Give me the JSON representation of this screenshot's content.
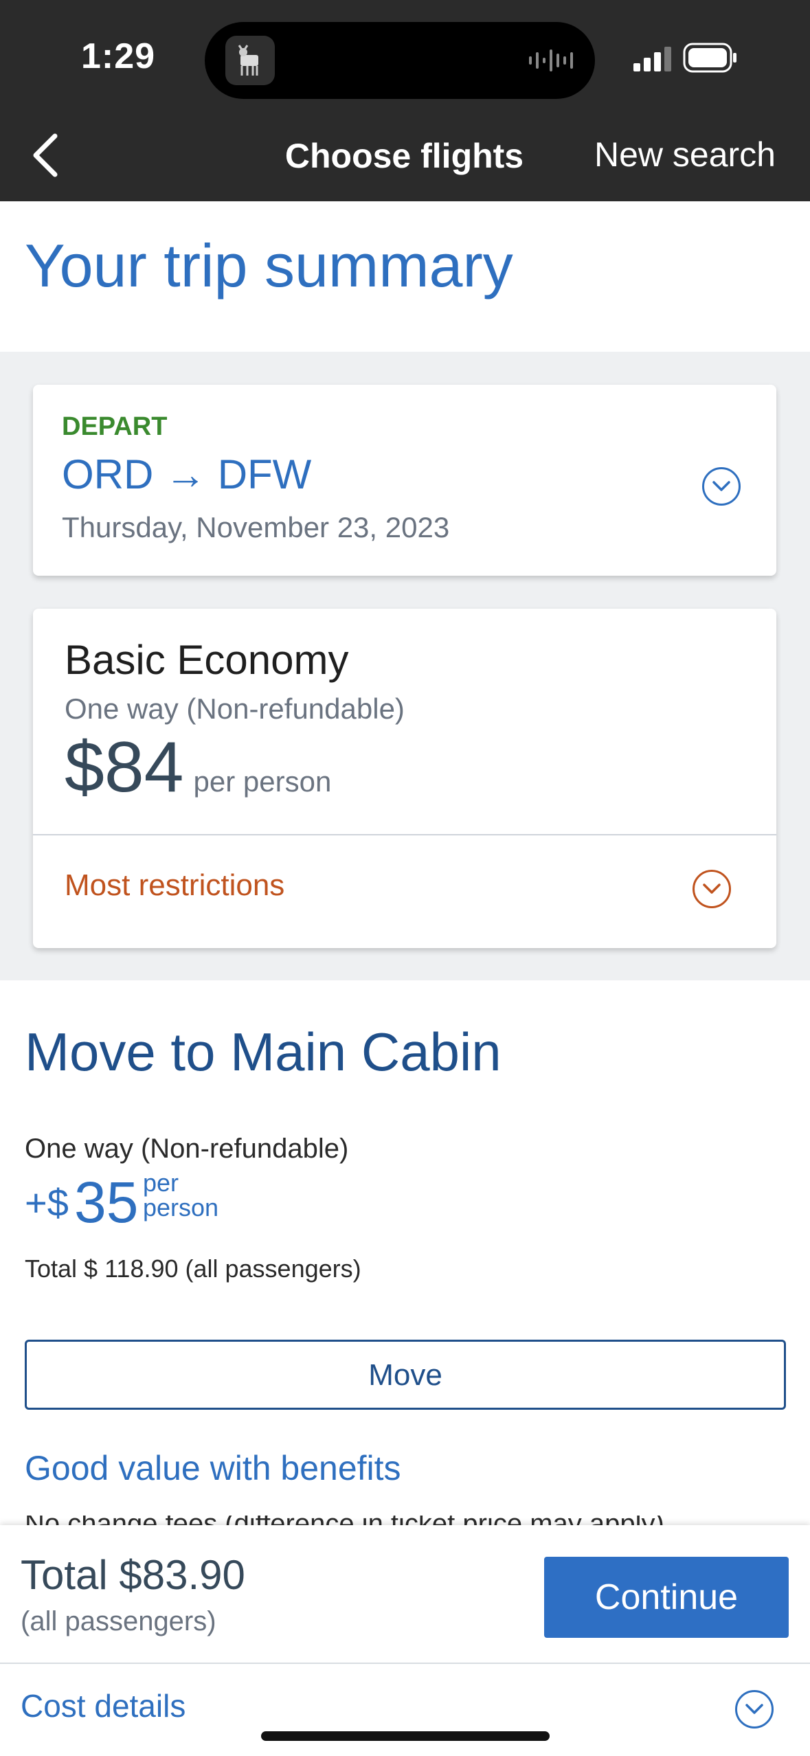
{
  "status_bar": {
    "time": "1:29"
  },
  "nav": {
    "title": "Choose flights",
    "new_search": "New search"
  },
  "page_title": "Your trip summary",
  "depart": {
    "label": "DEPART",
    "origin": "ORD",
    "arrow": "→",
    "destination": "DFW",
    "date": "Thursday, November 23, 2023"
  },
  "fare": {
    "name": "Basic Economy",
    "type": "One way (Non-refundable)",
    "price": "$84",
    "per": "per person",
    "restrictions": "Most restrictions"
  },
  "upgrade": {
    "title": "Move to Main Cabin",
    "type": "One way (Non-refundable)",
    "prefix": "+$",
    "amount": "35",
    "per_line1": "per",
    "per_line2": "person",
    "total": "Total $ 118.90 (all passengers)",
    "button": "Move",
    "benefits_title": "Good value with benefits",
    "benefit_peek": "No change fees (difference in ticket price may apply)"
  },
  "footer": {
    "total": "Total $83.90",
    "total_sub": "(all passengers)",
    "continue": "Continue",
    "cost_details": "Cost details"
  },
  "icons": {
    "back": "chevron-left-icon",
    "expand": "chevron-down-circle-icon",
    "signal": "cellular-signal-icon",
    "battery": "battery-icon"
  },
  "colors": {
    "accent_blue": "#2e6fbf",
    "dark_blue": "#1f4f8a",
    "depart_green": "#3a8a2e",
    "restriction_orange": "#c0531e",
    "nav_bg": "#2b2b2b",
    "continue_bg": "#2e6fc4"
  }
}
